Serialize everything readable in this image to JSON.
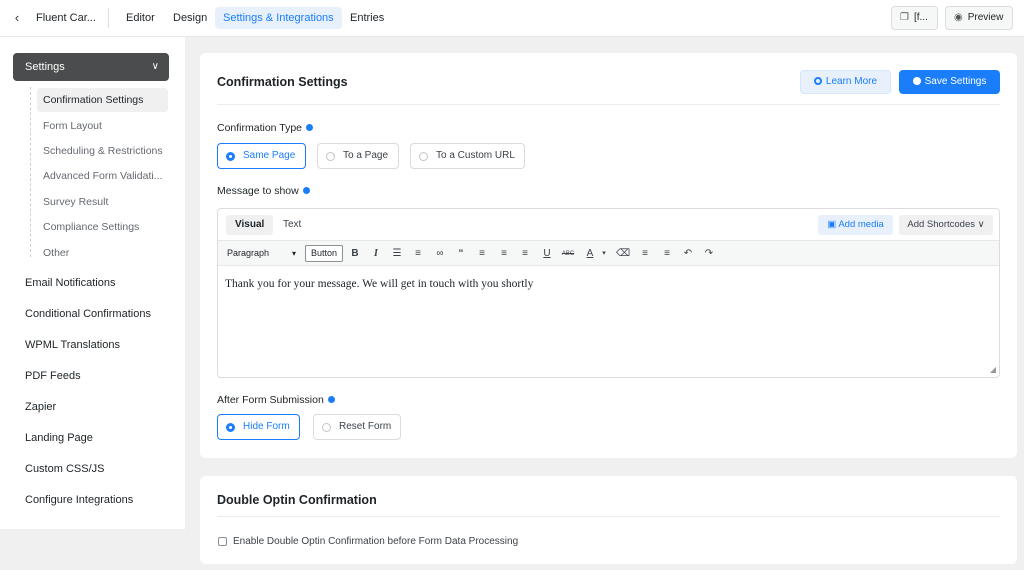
{
  "topbar": {
    "back_icon": "chevron-left-icon",
    "form_name": "Fluent Car...",
    "tabs": [
      {
        "label": "Editor"
      },
      {
        "label": "Design"
      },
      {
        "label": "Settings & Integrations"
      },
      {
        "label": "Entries"
      }
    ],
    "shortcode_label": "[f...",
    "preview_label": "Preview"
  },
  "sidebar": {
    "settings_label": "Settings",
    "sub_items": [
      {
        "label": "Confirmation Settings"
      },
      {
        "label": "Form Layout"
      },
      {
        "label": "Scheduling & Restrictions"
      },
      {
        "label": "Advanced Form Validati..."
      },
      {
        "label": "Survey Result"
      },
      {
        "label": "Compliance Settings"
      },
      {
        "label": "Other"
      }
    ],
    "items": [
      {
        "label": "Email Notifications"
      },
      {
        "label": "Conditional Confirmations"
      },
      {
        "label": "WPML Translations"
      },
      {
        "label": "PDF Feeds"
      },
      {
        "label": "Zapier"
      },
      {
        "label": "Landing Page"
      },
      {
        "label": "Custom CSS/JS"
      },
      {
        "label": "Configure Integrations"
      }
    ]
  },
  "confirmation": {
    "title": "Confirmation Settings",
    "learn_more": "Learn More",
    "save_settings": "Save Settings",
    "type_label": "Confirmation Type",
    "type_options": [
      {
        "label": "Same Page",
        "selected": true
      },
      {
        "label": "To a Page",
        "selected": false
      },
      {
        "label": "To a Custom URL",
        "selected": false
      }
    ],
    "message_label": "Message to show",
    "editor": {
      "tab_visual": "Visual",
      "tab_text": "Text",
      "add_media": "Add media",
      "add_shortcodes": "Add Shortcodes",
      "format_select": "Paragraph",
      "button_label": "Button",
      "content": "Thank you for your message. We will get in touch with you shortly"
    },
    "after_label": "After Form Submission",
    "after_options": [
      {
        "label": "Hide Form",
        "selected": true
      },
      {
        "label": "Reset Form",
        "selected": false
      }
    ]
  },
  "double_optin": {
    "title": "Double Optin Confirmation",
    "checkbox_label": "Enable Double Optin Confirmation before Form Data Processing",
    "checked": false
  },
  "colors": {
    "accent": "#1a7efb",
    "sidebar_header": "#4b4c4d"
  }
}
